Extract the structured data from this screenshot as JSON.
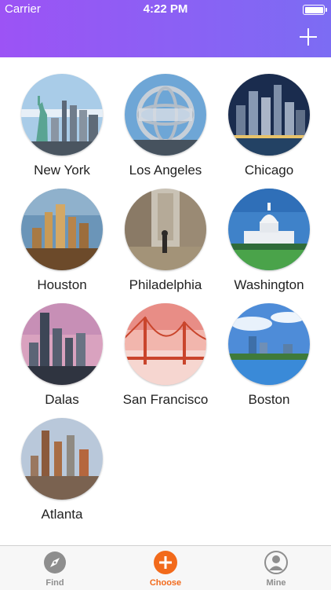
{
  "status": {
    "carrier": "Carrier",
    "time": "4:22 PM"
  },
  "header": {
    "add_icon": "plus-icon"
  },
  "cities": [
    {
      "name": "New York"
    },
    {
      "name": "Los Angeles"
    },
    {
      "name": "Chicago"
    },
    {
      "name": "Houston"
    },
    {
      "name": "Philadelphia"
    },
    {
      "name": "Washington"
    },
    {
      "name": "Dalas"
    },
    {
      "name": "San Francisco"
    },
    {
      "name": "Boston"
    },
    {
      "name": "Atlanta"
    }
  ],
  "tabs": [
    {
      "label": "Find",
      "icon": "compass-icon",
      "active": false
    },
    {
      "label": "Choose",
      "icon": "plus-circle-icon",
      "active": true
    },
    {
      "label": "Mine",
      "icon": "person-icon",
      "active": false
    }
  ],
  "colors": {
    "header_start": "#9c53f5",
    "header_end": "#7c6cf3",
    "tab_active": "#f26a1b",
    "tab_inactive": "#8e8e8e"
  }
}
